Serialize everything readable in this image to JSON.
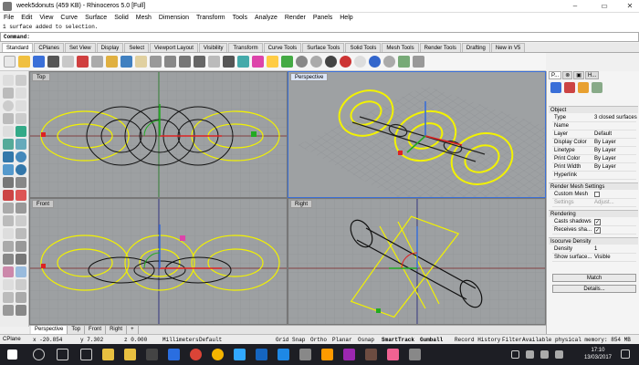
{
  "window": {
    "title": "week5donuts (459 KB) - Rhinoceros 5.0 [Full]",
    "minimize": "–",
    "maximize": "▭",
    "close": "✕"
  },
  "menu": [
    "File",
    "Edit",
    "View",
    "Curve",
    "Surface",
    "Solid",
    "Mesh",
    "Dimension",
    "Transform",
    "Tools",
    "Analyze",
    "Render",
    "Panels",
    "Help"
  ],
  "command": {
    "history": "1 surface added to selection.",
    "prompt": "Command:"
  },
  "toolbar_tabs": [
    "Standard",
    "CPlanes",
    "Set View",
    "Display",
    "Select",
    "Viewport Layout",
    "Visibility",
    "Transform",
    "Curve Tools",
    "Surface Tools",
    "Solid Tools",
    "Mesh Tools",
    "Render Tools",
    "Drafting",
    "New in V5"
  ],
  "viewports": {
    "top": "Top",
    "perspective": "Perspective",
    "front": "Front",
    "right": "Right"
  },
  "viewport_tabs": [
    "Perspective",
    "Top",
    "Front",
    "Right",
    "+"
  ],
  "status": {
    "cplane": "CPlane",
    "x": "x -20.854",
    "y": "y 7.302",
    "z": "z 0.000",
    "units": "Millimeters",
    "layer": "Default",
    "toggles": [
      "Grid Snap",
      "Ortho",
      "Planar",
      "Osnap",
      "SmartTrack",
      "Gumball",
      "Record History",
      "Filter"
    ],
    "memory": "Available physical memory: 854 MB"
  },
  "properties": {
    "tabs": [
      "P...",
      "⊗",
      "▣",
      "H..."
    ],
    "section_object": "Object",
    "rows": [
      {
        "k": "Type",
        "v": "3 closed surfaces"
      },
      {
        "k": "Name",
        "v": ""
      },
      {
        "k": "Layer",
        "v": "Default"
      },
      {
        "k": "Display Color",
        "v": "By Layer"
      },
      {
        "k": "Linetype",
        "v": "By Layer"
      },
      {
        "k": "Print Color",
        "v": "By Layer"
      },
      {
        "k": "Print Width",
        "v": "By Layer"
      },
      {
        "k": "Hyperlink",
        "v": ""
      }
    ],
    "section_render_mesh": "Render Mesh Settings",
    "custom_mesh": "Custom Mesh",
    "settings": "Settings",
    "adjust": "Adjust...",
    "section_rendering": "Rendering",
    "casts_shadows": "Casts shadows",
    "receives_shadows": "Receives sha...",
    "section_isocurve": "Isocurve Density",
    "density": "Density",
    "density_value": "1",
    "show_surface": "Show surface...",
    "visible": "Visible",
    "match": "Match",
    "details": "Details..."
  },
  "clock": {
    "time": "17:10",
    "date": "13/03/2017"
  },
  "colors": {
    "yellow": "#f2f200",
    "grid": "#9da0a2",
    "accent": "#3a6fd8"
  }
}
